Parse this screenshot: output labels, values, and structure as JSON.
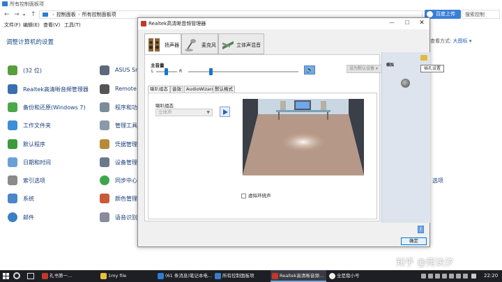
{
  "control_panel": {
    "window_title": "所有控制面板项",
    "breadcrumb": [
      "控制面板",
      "所有控制面板项"
    ],
    "menu": [
      "文件(F)",
      "编辑(E)",
      "查看(V)",
      "工具(T)"
    ],
    "heading": "调整计算机的设置",
    "view_by_label": "查看方式:",
    "view_by_value": "大图标 ▾",
    "baidu_button": "百度上传",
    "search_placeholder": "搜索控制",
    "left_items": [
      "(32 位)",
      "Realtek高清晰音频管理器",
      "备份和还原(Windows 7)",
      "工作文件夹",
      "默认程序",
      "日期和时间",
      "索引选项",
      "系统",
      "邮件"
    ],
    "right_items": [
      "ASUS Sr",
      "Remote",
      "程序和功",
      "管理工具",
      "凭据管理",
      "设备管理",
      "同步中心",
      "颜色管理",
      "语音识别"
    ],
    "partial_right": "选项"
  },
  "realtek": {
    "title": "Realtek高清晰音频管理器",
    "tabs": [
      "扬声器",
      "麦克风",
      "立体声混音"
    ],
    "main_volume_label": "主音量",
    "left": "L",
    "right": "R",
    "default_device": "设为默认设备",
    "subtabs": [
      "喇叭组态",
      "音效",
      "AudioWizard",
      "默认格式"
    ],
    "speaker_config_label": "喇叭组态",
    "speaker_config_value": "立体声",
    "virtual_surround": "虚拟环绕声",
    "side_label": "模拟",
    "tooltip": "插孔设置",
    "ok": "确定"
  },
  "taskbar": {
    "items": [
      "礼书第一…",
      "1my file",
      "(61 条消息)笔记本电…",
      "所有控制面板项",
      "Realtek高清晰音频…",
      "全是我小号"
    ],
    "clock": "22:20"
  },
  "watermark": "知乎 @宛诀汐",
  "colors": {
    "accent": "#1e73c9",
    "taskbar": "#1e1f24",
    "link": "#1a3f7a"
  }
}
